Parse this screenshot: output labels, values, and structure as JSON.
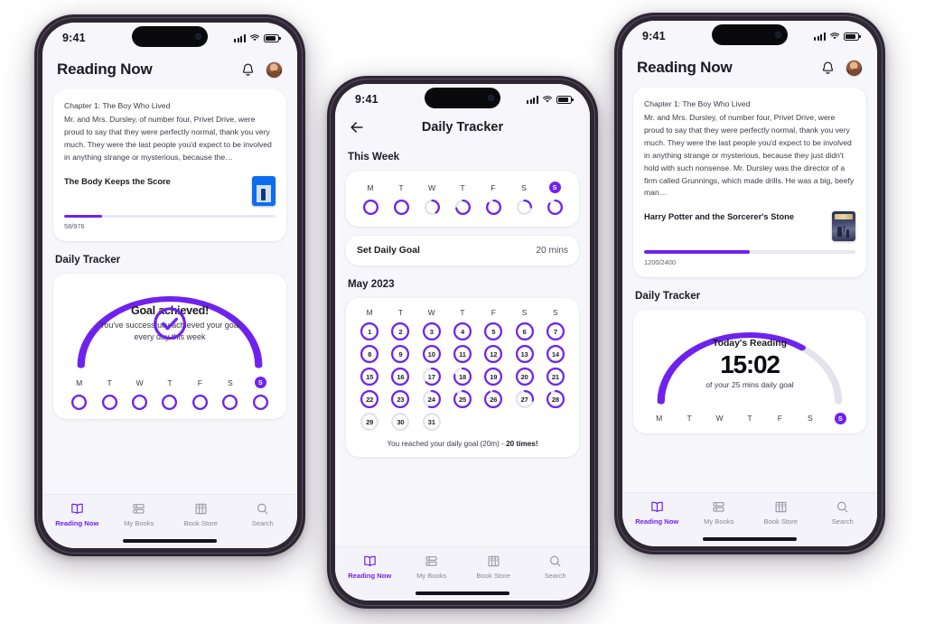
{
  "accent": "#6f22ef",
  "muted_track": "#e4e2ea",
  "status_bar": {
    "time": "9:41",
    "signal_icon": "cellular-bars-icon",
    "wifi_icon": "wifi-icon",
    "battery_icon": "battery-icon"
  },
  "phone_left": {
    "header": {
      "title": "Reading Now",
      "bell_icon": "bell-icon",
      "avatar_icon": "avatar"
    },
    "reading_card": {
      "chapter": "Chapter 1: The Boy Who Lived",
      "excerpt": "Mr. and Mrs. Dursley, of number four, Privet Drive, were proud to say that they were perfectly normal, thank you very much. They were the last people you'd expect to be involved in anything strange or mysterious, because the…",
      "book_title": "The Body Keeps the Score",
      "progress_label": "58/976",
      "progress_percent": 18
    },
    "tracker": {
      "section_title": "Daily Tracker",
      "check_icon": "check-circle-icon",
      "headline": "Goal achieved!",
      "subtext": "You've successfully achieved your goal every day this week",
      "arc_percent": 100,
      "weekdays": [
        "M",
        "T",
        "W",
        "T",
        "F",
        "S",
        "S"
      ],
      "today_index": 6,
      "day_rings": [
        100,
        100,
        100,
        100,
        100,
        100,
        100
      ]
    },
    "tabs": [
      {
        "label": "Reading Now",
        "icon": "open-book-icon",
        "active": true
      },
      {
        "label": "My Books",
        "icon": "stacked-books-icon",
        "active": false
      },
      {
        "label": "Book Store",
        "icon": "bookshelf-icon",
        "active": false
      },
      {
        "label": "Search",
        "icon": "search-icon",
        "active": false
      }
    ]
  },
  "phone_center": {
    "nav": {
      "back_icon": "back-arrow-icon",
      "title": "Daily Tracker"
    },
    "this_week": {
      "section_title": "This Week",
      "weekdays": [
        "M",
        "T",
        "W",
        "T",
        "F",
        "S",
        "S"
      ],
      "today_index": 6,
      "day_rings": [
        100,
        100,
        40,
        72,
        85,
        25,
        84
      ]
    },
    "daily_goal": {
      "label": "Set Daily Goal",
      "value": "20 mins"
    },
    "calendar": {
      "month_title": "May 2023",
      "weekday_headers": [
        "M",
        "T",
        "W",
        "T",
        "F",
        "S",
        "S"
      ],
      "days": [
        {
          "n": "1",
          "p": 100
        },
        {
          "n": "2",
          "p": 100
        },
        {
          "n": "3",
          "p": 100
        },
        {
          "n": "4",
          "p": 100
        },
        {
          "n": "5",
          "p": 100
        },
        {
          "n": "6",
          "p": 100
        },
        {
          "n": "7",
          "p": 100
        },
        {
          "n": "8",
          "p": 100
        },
        {
          "n": "9",
          "p": 100
        },
        {
          "n": "10",
          "p": 100
        },
        {
          "n": "11",
          "p": 100
        },
        {
          "n": "12",
          "p": 100
        },
        {
          "n": "13",
          "p": 100
        },
        {
          "n": "14",
          "p": 100
        },
        {
          "n": "15",
          "p": 100
        },
        {
          "n": "16",
          "p": 100
        },
        {
          "n": "17",
          "p": 62
        },
        {
          "n": "18",
          "p": 78
        },
        {
          "n": "19",
          "p": 100
        },
        {
          "n": "20",
          "p": 100
        },
        {
          "n": "21",
          "p": 100
        },
        {
          "n": "22",
          "p": 100
        },
        {
          "n": "23",
          "p": 100
        },
        {
          "n": "24",
          "p": 55
        },
        {
          "n": "25",
          "p": 86
        },
        {
          "n": "26",
          "p": 92
        },
        {
          "n": "27",
          "p": 28
        },
        {
          "n": "28",
          "p": 88
        },
        {
          "n": "29",
          "p": 0
        },
        {
          "n": "30",
          "p": 0
        },
        {
          "n": "31",
          "p": 0
        }
      ],
      "footer_text": "You reached your daily goal (20m) - ",
      "footer_highlight": "20 times!"
    },
    "tabs": [
      {
        "label": "Reading Now",
        "icon": "open-book-icon",
        "active": true
      },
      {
        "label": "My Books",
        "icon": "stacked-books-icon",
        "active": false
      },
      {
        "label": "Book Store",
        "icon": "bookshelf-icon",
        "active": false
      },
      {
        "label": "Search",
        "icon": "search-icon",
        "active": false
      }
    ]
  },
  "phone_right": {
    "header": {
      "title": "Reading Now",
      "bell_icon": "bell-icon",
      "avatar_icon": "avatar"
    },
    "reading_card": {
      "chapter": "Chapter 1: The Boy Who Lived",
      "excerpt": "Mr. and Mrs. Dursley, of number four, Privet Drive, were proud to say that they were perfectly normal, thank you very much. They were the last people you'd expect to be involved in anything strange or mysterious, because they just didn't hold with such nonsense. Mr. Dursley was the director of a firm called Grunnings, which made drills. He was a big, beefy man…",
      "book_title": "Harry Potter and the Sorcerer's Stone",
      "progress_label": "1200/2400",
      "progress_percent": 50
    },
    "tracker": {
      "section_title": "Daily Tracker",
      "headline": "Today's Reading",
      "time_value": "15:02",
      "subtext": "of your 25 mins daily goal",
      "arc_percent": 70,
      "weekdays": [
        "M",
        "T",
        "W",
        "T",
        "F",
        "S",
        "S"
      ],
      "today_index": 6
    },
    "tabs": [
      {
        "label": "Reading Now",
        "icon": "open-book-icon",
        "active": true
      },
      {
        "label": "My Books",
        "icon": "stacked-books-icon",
        "active": false
      },
      {
        "label": "Book Store",
        "icon": "bookshelf-icon",
        "active": false
      },
      {
        "label": "Search",
        "icon": "search-icon",
        "active": false
      }
    ]
  }
}
